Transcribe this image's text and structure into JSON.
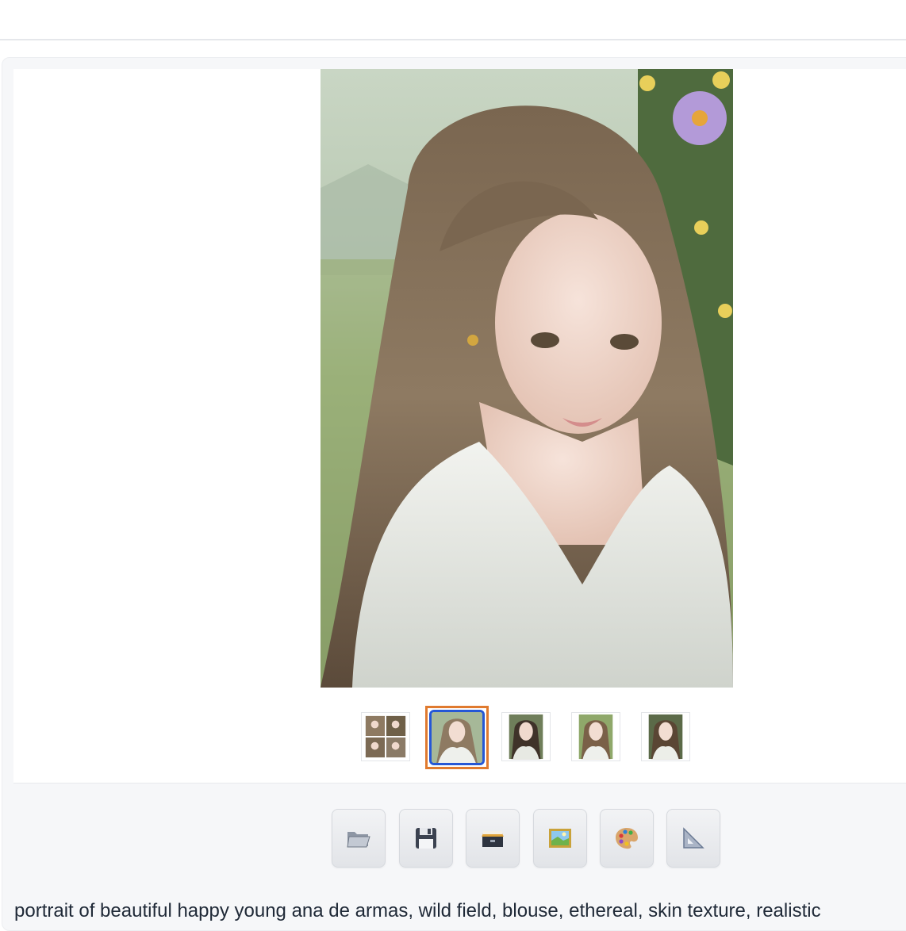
{
  "gallery": {
    "main_image_alt": "generated portrait",
    "thumbnails": [
      {
        "name": "grid",
        "selected": false
      },
      {
        "name": "portrait-1",
        "selected": true
      },
      {
        "name": "portrait-2",
        "selected": false
      },
      {
        "name": "portrait-3",
        "selected": false
      },
      {
        "name": "portrait-4",
        "selected": false
      }
    ]
  },
  "toolbar": {
    "buttons": [
      {
        "icon": "folder-icon"
      },
      {
        "icon": "save-icon"
      },
      {
        "icon": "archive-icon"
      },
      {
        "icon": "picture-icon"
      },
      {
        "icon": "palette-icon"
      },
      {
        "icon": "triangle-ruler-icon"
      }
    ]
  },
  "prompt": {
    "text": "portrait of beautiful happy young ana de armas, wild field, blouse, ethereal, skin texture, realistic"
  },
  "colors": {
    "selected_outer": "#e07a2f",
    "selected_inner": "#2557d6"
  }
}
